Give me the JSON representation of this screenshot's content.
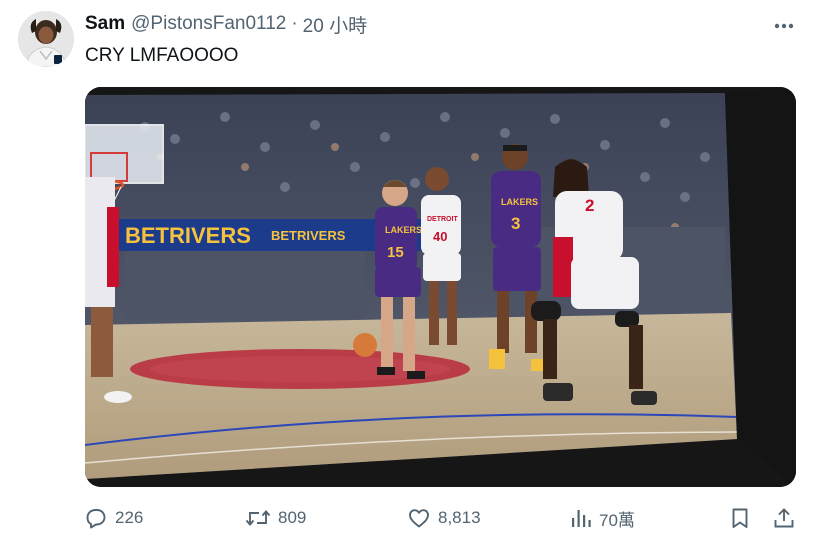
{
  "tweet": {
    "author_name": "Sam",
    "handle": "@PistonsFan0112",
    "separator": "·",
    "time": "20 小時",
    "text": "CRY LMFAOOOO"
  },
  "video": {
    "court_banner_primary": "BETRIVERS",
    "court_banner_secondary": "BETRIVERS",
    "player_left_number": "15",
    "player_left_team": "LAKERS",
    "player_mid_number": "3",
    "player_mid_team": "LAKERS",
    "player_white_number": "40",
    "player_white_team": "DETROIT",
    "player_right_number": "2"
  },
  "actions": {
    "reply_count": "226",
    "retweet_count": "809",
    "like_count": "8,813",
    "view_count": "70萬"
  },
  "colors": {
    "text_primary": "#0f1419",
    "text_secondary": "#536471",
    "lakers_purple": "#4a2b84",
    "lakers_gold": "#f4c23c",
    "pistons_red": "#c8102e",
    "pistons_blue": "#1d42ba"
  },
  "icons": [
    "more-icon",
    "reply-icon",
    "retweet-icon",
    "like-icon",
    "views-icon",
    "bookmark-icon",
    "share-icon"
  ]
}
